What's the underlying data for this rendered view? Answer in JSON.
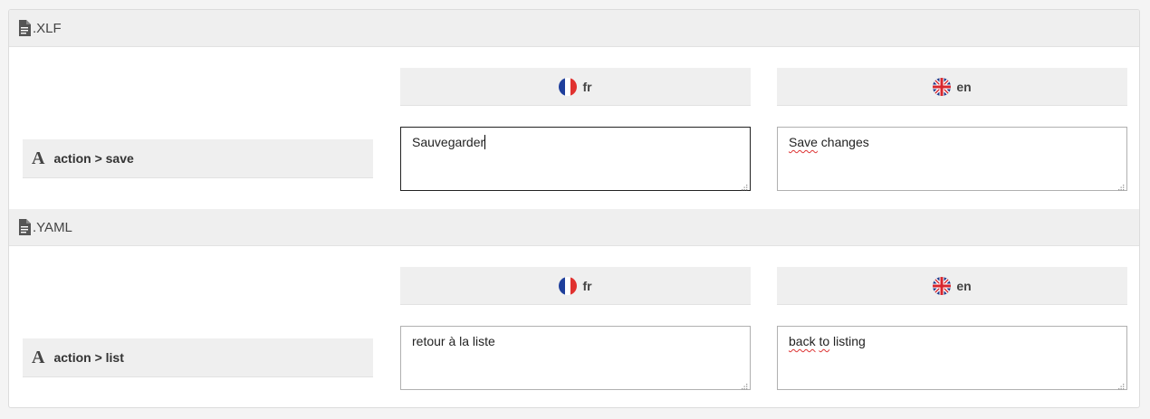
{
  "sections": [
    {
      "extension": ".XLF",
      "key": "action > save",
      "languages": [
        {
          "code": "fr",
          "value": "Sauvegarder"
        },
        {
          "code": "en",
          "value_spellcheck": "Save",
          "value_rest": " changes"
        }
      ]
    },
    {
      "extension": ".YAML",
      "key": "action > list",
      "languages": [
        {
          "code": "fr",
          "value": "retour à la liste"
        },
        {
          "code": "en",
          "value_w1": "back",
          "value_sp1": " ",
          "value_w2": "to",
          "value_rest": " listing"
        }
      ]
    }
  ],
  "icons": {
    "file": "file-text-icon",
    "font": "font-icon",
    "fr_flag": "france-flag-icon",
    "en_flag": "uk-flag-icon",
    "grip": "resize-grip-icon"
  },
  "colors": {
    "header_bg": "#efefef",
    "border": "#b0b0b0",
    "focused_border": "#222222",
    "spellcheck": "#dd3333"
  }
}
